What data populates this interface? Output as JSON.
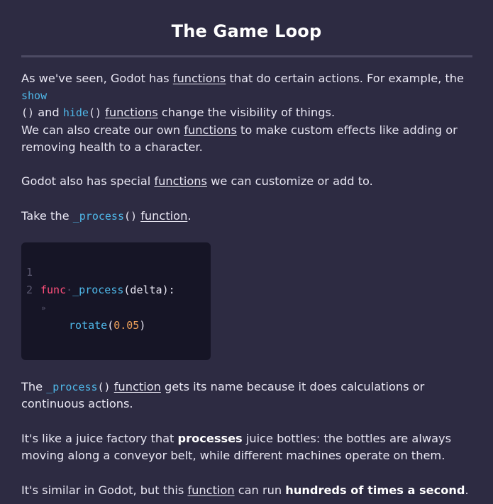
{
  "title": "The Game Loop",
  "p1": {
    "t1": "As we've seen, Godot has ",
    "link1": "functions",
    "t2": " that do certain actions. For example, the ",
    "code1": "show",
    "code1_paren": "()",
    "t3": " and ",
    "code2": "hide",
    "code2_paren": "()",
    "t4": " ",
    "link2": "functions",
    "t5": " change the visibility of things."
  },
  "p2": {
    "t1": "We can also create our own ",
    "link1": "functions",
    "t2": " to make custom effects like adding or removing health to a character."
  },
  "p3": {
    "t1": "Godot also has special ",
    "link1": "functions",
    "t2": " we can customize or add to."
  },
  "p4": {
    "t1": "Take the ",
    "code1": "_process",
    "code1_paren": "()",
    "t2": " ",
    "link1": "function",
    "t3": "."
  },
  "code_block": {
    "line1": {
      "num": "1",
      "kw": "func",
      "dot": "·",
      "name": "_process",
      "rest": "(delta):"
    },
    "line2": {
      "num": "2",
      "tab": "»",
      "fn": "rotate",
      "open": "(",
      "arg": "0.05",
      "close": ")"
    }
  },
  "p5": {
    "t1": "The ",
    "code1": "_process",
    "code1_paren": "()",
    "t2": " ",
    "link1": "function",
    "t3": " gets its name because it does calculations or continuous actions."
  },
  "p6": {
    "t1": "It's like a juice factory that ",
    "b1": "processes",
    "t2": " juice bottles: the bottles are always moving along a conveyor belt, while different machines operate on them."
  },
  "p7": {
    "t1": "It's similar in Godot, but this ",
    "link1": "function",
    "t2": " can run ",
    "b1": "hundreds of times a second",
    "t3": "."
  },
  "colors": {
    "background": "#2d2b42",
    "code_background": "#161526",
    "keyword": "#ff4f7b",
    "identifier": "#4fb7e8",
    "number": "#f0a25a"
  }
}
